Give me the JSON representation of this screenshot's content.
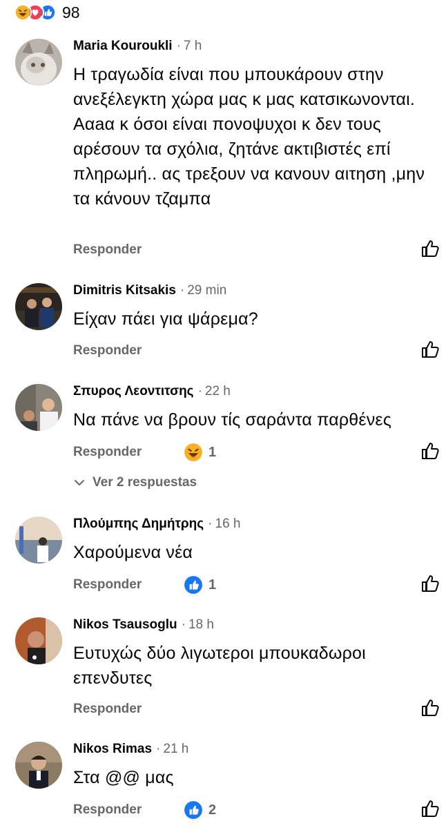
{
  "reactions_summary": {
    "count": "98",
    "icons": [
      "haha-icon",
      "love-icon",
      "like-icon"
    ]
  },
  "comments": [
    {
      "author": "Maria Kouroukli",
      "time": "7 h",
      "text": "Η τραγωδία είναι που μπουκάρουν στην ανεξέλεγκτη χώρα μας κ μας κατσικωνονται. Ααaα κ όσοι είναι πονοψυχοι κ δεν τους αρέσουν τα σχόλια, ζητάνε ακτιβιστές επί πληρωμή.. ας τρεξουν να κανουν αιτηση ,μην τα κάνουν τζαμπα",
      "reply_label": "Responder",
      "reaction": null
    },
    {
      "author": "Dimitris Kitsakis",
      "time": "29 min",
      "text": "Είχαν πάει για ψάρεμα?",
      "reply_label": "Responder",
      "reaction": null
    },
    {
      "author": "Σπυρος Λεοντιτσης",
      "time": "22 h",
      "text": "Να πάνε να βρουν τίς σαράντα παρθένες",
      "reply_label": "Responder",
      "reaction": {
        "icon": "haha-icon",
        "count": "1"
      },
      "view_replies": "Ver 2 respuestas"
    },
    {
      "author": "Πλούμπης Δημήτρης",
      "time": "16 h",
      "text": "Χαρούμενα νέα",
      "reply_label": "Responder",
      "reaction": {
        "icon": "like-icon",
        "count": "1"
      }
    },
    {
      "author": "Nikos Tsausoglu",
      "time": "18 h",
      "text": "Ευτυχώς δύο λιγωτεροι μπουκαδωροι επενδυτες",
      "reply_label": "Responder",
      "reaction": null
    },
    {
      "author": "Nikos Rimas",
      "time": "21 h",
      "text": "Στα @@ μας",
      "reply_label": "Responder",
      "reaction": {
        "icon": "like-icon",
        "count": "2"
      }
    }
  ],
  "colors": {
    "text": "#050505",
    "secondary": "#65676b",
    "like_blue": "#1877f2",
    "love_red": "#f33e58",
    "haha_yellow": "#f7b125"
  }
}
